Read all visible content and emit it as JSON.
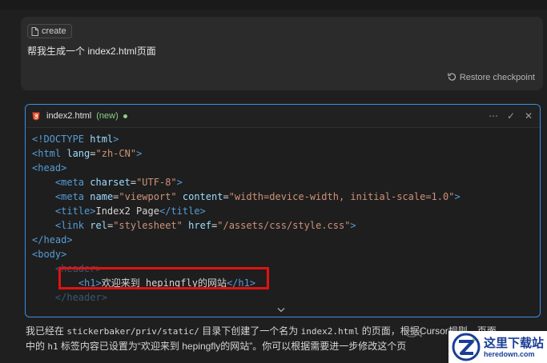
{
  "chat": {
    "chip_label": "create",
    "prompt": "帮我生成一个 index2.html页面",
    "restore_label": "Restore checkpoint"
  },
  "code_block": {
    "file_name": "index2.html",
    "status": "(new)",
    "actions": [
      "⋯",
      "✓",
      "✕"
    ],
    "lines": {
      "l1": [
        "<!DOCTYPE ",
        "html",
        ">"
      ],
      "l2": [
        "<html ",
        "lang",
        "=",
        "\"zh-CN\"",
        ">"
      ],
      "l3": [
        "<head>"
      ],
      "l4": [
        "<meta ",
        "charset",
        "=",
        "\"UTF-8\"",
        ">"
      ],
      "l5": [
        "<meta ",
        "name",
        "=",
        "\"viewport\"",
        " content",
        "=",
        "\"width=device-width, initial-scale=1.0\"",
        ">"
      ],
      "l6": [
        "<title>",
        "Index2 Page",
        "</title>"
      ],
      "l7": [
        "<link ",
        "rel",
        "=",
        "\"stylesheet\"",
        " href",
        "=",
        "\"/assets/css/style.css\"",
        ">"
      ],
      "l8": [
        "</head>"
      ],
      "l9": [
        "<body>"
      ],
      "l10": [
        "<header>"
      ],
      "l11": [
        "<h1>",
        "欢迎来到 hepingfly的网站",
        "</h1>"
      ],
      "l12": [
        "</header>"
      ]
    }
  },
  "answer": {
    "p1": "我已经在 ",
    "path": "stickerbaker/priv/static/",
    "p2": " 目录下创建了一个名为 ",
    "file": "index2.html",
    "p3": " 的页面，根据Cursor规则，页面",
    "p4": "中的 ",
    "tag": "h1",
    "p5": " 标签内容已设置为“欢迎来到 hepingfly的网站”。你可以根据需要进一步修改这个页"
  },
  "watermark": {
    "cn": "这里下载站",
    "url": "heredown.com"
  },
  "colors": {
    "accent": "#3b8eea",
    "highlight": "#e01212",
    "new": "#89d185"
  }
}
